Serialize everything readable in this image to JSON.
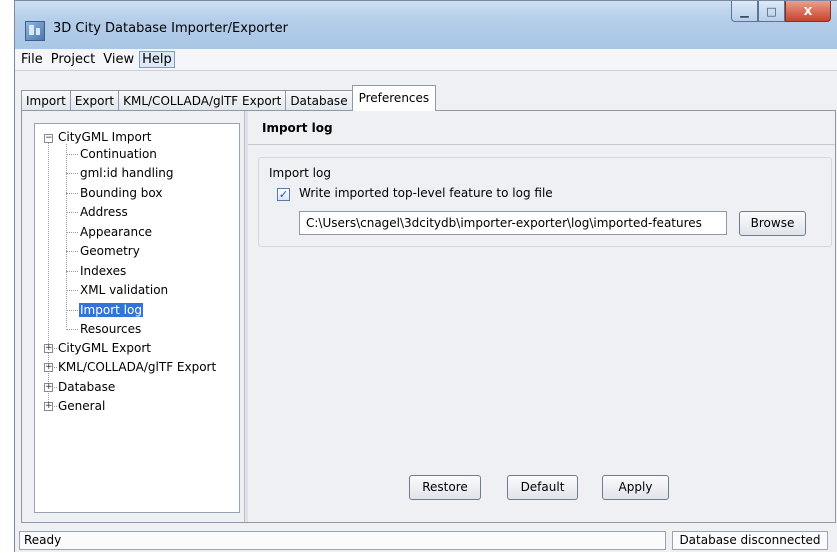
{
  "window": {
    "title": "3D City Database Importer/Exporter",
    "controls": {
      "minimize": "▁",
      "maximize": "□",
      "close": "X"
    }
  },
  "menubar": [
    "File",
    "Project",
    "View",
    "Help"
  ],
  "tabs": [
    "Import",
    "Export",
    "KML/COLLADA/glTF Export",
    "Database",
    "Preferences"
  ],
  "tree": {
    "citygml_import": "CityGML Import",
    "children": [
      "Continuation",
      "gml:id handling",
      "Bounding box",
      "Address",
      "Appearance",
      "Geometry",
      "Indexes",
      "XML validation",
      "Import log",
      "Resources"
    ],
    "collapsed": [
      "CityGML Export",
      "KML/COLLADA/glTF Export",
      "Database",
      "General"
    ]
  },
  "panel": {
    "header": "Import log",
    "group_title": "Import log",
    "checkbox_label": "Write imported top-level feature to log file",
    "checkbox_checked": true,
    "path_value": "C:\\Users\\cnagel\\3dcitydb\\importer-exporter\\log\\imported-features",
    "browse_label": "Browse"
  },
  "buttons": {
    "restore": "Restore",
    "default": "Default",
    "apply": "Apply"
  },
  "status": {
    "left": "Ready",
    "right": "Database disconnected"
  },
  "colors": {
    "selection": "#3375d6",
    "titlebar": "#b4cde9",
    "close": "#c8432b"
  }
}
